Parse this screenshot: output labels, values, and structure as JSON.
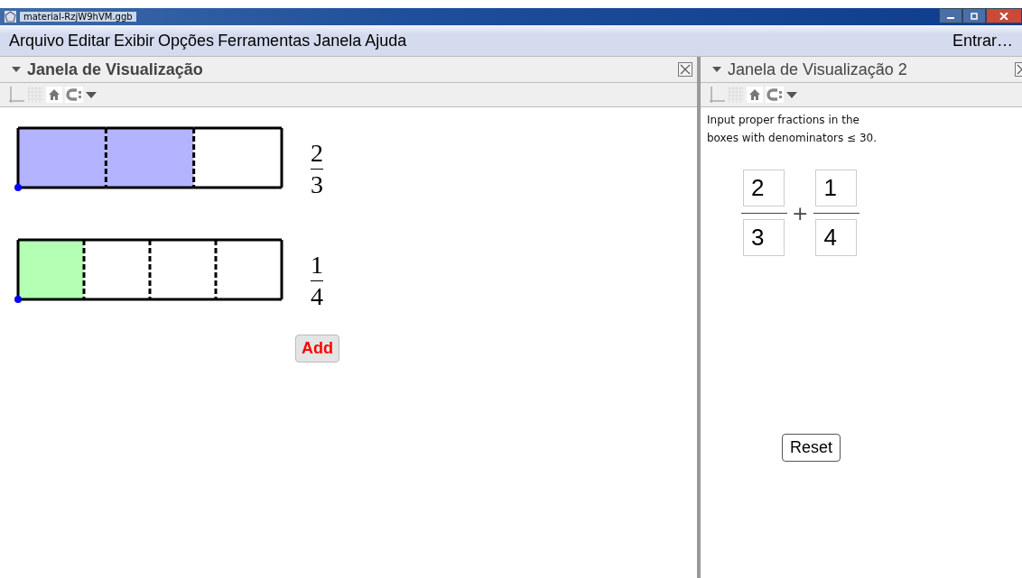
{
  "window": {
    "title": "material-RzjW9hVM.ggb"
  },
  "menu": {
    "items": [
      "Arquivo",
      "Editar",
      "Exibir",
      "Opções",
      "Ferramentas",
      "Janela",
      "Ajuda"
    ],
    "login": "Entrar…"
  },
  "left_panel": {
    "title": "Janela de Visualização",
    "bold": true,
    "bars": [
      {
        "color": "#b3b3ff",
        "segments": [
          {
            "shaded": true
          },
          {
            "shaded": true
          },
          {
            "shaded": false
          }
        ],
        "numerator": "2",
        "denominator": "3"
      },
      {
        "color": "#b3ffb3",
        "segments": [
          {
            "shaded": true
          },
          {
            "shaded": false
          },
          {
            "shaded": false
          },
          {
            "shaded": false
          }
        ],
        "numerator": "1",
        "denominator": "4"
      }
    ],
    "add_button": "Add"
  },
  "right_panel": {
    "title": "Janela de Visualização 2",
    "bold": false,
    "instruction_lines": [
      "Input proper fractions in the",
      "boxes with denominators ≤ 30."
    ],
    "fractions": [
      {
        "numerator": "2",
        "denominator": "3"
      },
      {
        "numerator": "1",
        "denominator": "4"
      }
    ],
    "operator": "+",
    "reset_button": "Reset"
  }
}
